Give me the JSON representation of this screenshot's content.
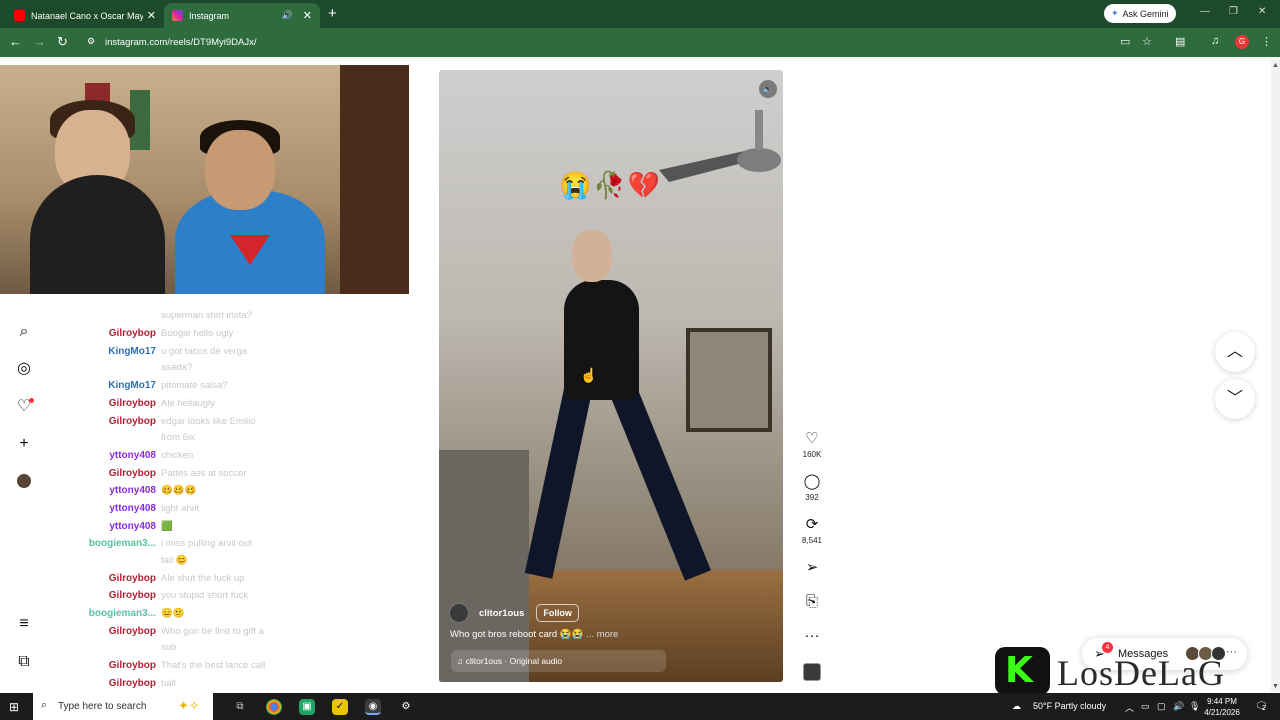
{
  "browser": {
    "tabs": [
      {
        "title": "Natanael Cano x Oscar Maydon",
        "favicon_color": "#ff0000"
      },
      {
        "title": "Instagram",
        "favicon_color": "#d6249f"
      }
    ],
    "ask_gemini": "Ask Gemini",
    "url": "instagram.com/reels/DT9Myi9DAJx/",
    "profile_initial": "G"
  },
  "chat": [
    {
      "user": "",
      "msg": "superman shirt insta?",
      "color": "#c9c9c9"
    },
    {
      "user": "Gilroybop",
      "msg": "Boogie hello ugly",
      "color": "#b22234"
    },
    {
      "user": "KingMo17",
      "msg": "u got tacos de verga",
      "color": "#2f6fb5"
    },
    {
      "user": "",
      "msg": "asada?",
      "color": "#c9c9c9"
    },
    {
      "user": "KingMo17",
      "msg": "pitomate salsa?",
      "color": "#2f6fb5"
    },
    {
      "user": "Gilroybop",
      "msg": "Ale hellaugly",
      "color": "#b22234"
    },
    {
      "user": "Gilroybop",
      "msg": "edgar looks like Emilio",
      "color": "#b22234"
    },
    {
      "user": "",
      "msg": "from 6ix",
      "color": "#c9c9c9"
    },
    {
      "user": "yttony408",
      "msg": "chicken",
      "color": "#8a2be2"
    },
    {
      "user": "Gilroybop",
      "msg": "Pattes ass at soccer",
      "color": "#b22234"
    },
    {
      "user": "yttony408",
      "msg": "🥴🥴🥴",
      "color": "#8a2be2"
    },
    {
      "user": "yttony408",
      "msg": "light arvit",
      "color": "#8a2be2"
    },
    {
      "user": "yttony408",
      "msg": "🟩",
      "color": "#8a2be2"
    },
    {
      "user": "boogieman3...",
      "msg": "i miss pulling arvit out",
      "color": "#5bc0a8"
    },
    {
      "user": "",
      "msg": "tail 😊",
      "color": "#c9c9c9"
    },
    {
      "user": "Gilroybop",
      "msg": "Ale shut the fuck up",
      "color": "#b22234"
    },
    {
      "user": "Gilroybop",
      "msg": "you stupid short fuck",
      "color": "#b22234"
    },
    {
      "user": "boogieman3...",
      "msg": "😑😕",
      "color": "#5bc0a8"
    },
    {
      "user": "Gilroybop",
      "msg": "Who gon be first to gift a",
      "color": "#b22234"
    },
    {
      "user": "",
      "msg": "sub",
      "color": "#c9c9c9"
    },
    {
      "user": "Gilroybop",
      "msg": "That's the best lance call",
      "color": "#b22234"
    },
    {
      "user": "Gilroybop",
      "msg": "ball",
      "color": "#b22234"
    }
  ],
  "reel": {
    "emojis": "😭🥀💔",
    "username": "clitor1ous",
    "follow": "Follow",
    "caption": "Who got bros reboot card 😭😭",
    "more": "... more",
    "audio": "clitor1ous · Original audio",
    "mute_icon": "speaker-icon"
  },
  "actions": [
    {
      "name": "like",
      "icon": "♡",
      "count": "160K"
    },
    {
      "name": "comment",
      "icon": "◯",
      "count": "392"
    },
    {
      "name": "repost",
      "icon": "⟳",
      "count": "8,541"
    },
    {
      "name": "share",
      "icon": "➢",
      "count": ""
    },
    {
      "name": "save",
      "icon": "⎘",
      "count": ""
    },
    {
      "name": "more",
      "icon": "···",
      "count": ""
    }
  ],
  "messages": {
    "label": "Messages",
    "badge": "4"
  },
  "watermark": "LosDeLaG",
  "taskbar": {
    "search_placeholder": "Type here to search",
    "weather": "50°F  Partly cloudy",
    "time": "9:44 PM",
    "date": "4/21/2026",
    "notification_count": "2"
  }
}
